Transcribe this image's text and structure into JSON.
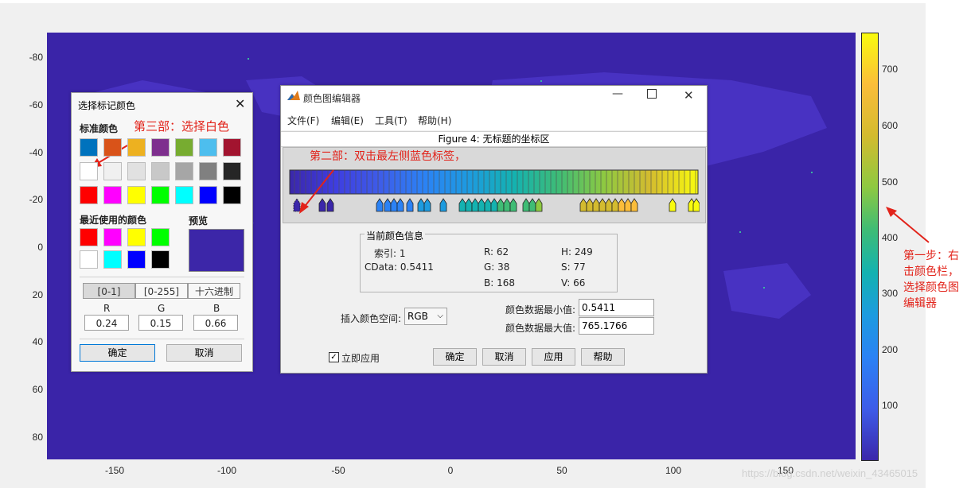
{
  "figure": {
    "y_ticks": [
      "-80",
      "-60",
      "-40",
      "-20",
      "0",
      "20",
      "40",
      "60",
      "80"
    ],
    "x_ticks": [
      "-150",
      "-100",
      "-50",
      "0",
      "50",
      "100",
      "150"
    ],
    "colorbar_ticks": [
      "700",
      "600",
      "500",
      "400",
      "300",
      "200",
      "100"
    ],
    "colormap_colors": [
      "#3b27aa",
      "#3e5ce8",
      "#2b82f5",
      "#1d9bdf",
      "#14b2b0",
      "#3fbc75",
      "#8ec941",
      "#d3bb2f",
      "#fbbd3a",
      "#f9fb0e"
    ],
    "background_color": "#3a24a8"
  },
  "annotations": {
    "step1": "第一步：右击颜色栏，选择颜色图编辑器",
    "step2": "第二部：双击最左侧蓝色标签，",
    "step3": "第三部：选择白色",
    "color": "#e2231a"
  },
  "marker_dialog": {
    "title": "选择标记颜色",
    "standard_colors_label": "标准颜色",
    "standard_colors": [
      "#0072bd",
      "#d95319",
      "#edb120",
      "#7e2f8e",
      "#77ac30",
      "#4dbeee",
      "#a2142f",
      "#ffffff",
      "#f0f0f0",
      "#e1e1e1",
      "#c8c8c8",
      "#a6a6a6",
      "#808080",
      "#262626",
      "#ff0000",
      "#ff00ff",
      "#ffff00",
      "#00ff00",
      "#00ffff",
      "#0000ff",
      "#000000"
    ],
    "recent_colors_label": "最近使用的颜色",
    "recent_colors": [
      "#ff0000",
      "#ff00ff",
      "#ffff00",
      "#00ff00",
      "#ffffff",
      "#00ffff",
      "#0000ff",
      "#000000"
    ],
    "preview_label": "预览",
    "preview_color": "#3c26a8",
    "modes": [
      "[0-1]",
      "[0-255]",
      "十六进制"
    ],
    "r_label": "R",
    "g_label": "G",
    "b_label": "B",
    "r_value": "0.24",
    "g_value": "0.15",
    "b_value": "0.66",
    "ok": "确定",
    "cancel": "取消"
  },
  "colormap_editor": {
    "title": "颜色图编辑器",
    "menus": [
      "文件(F)",
      "编辑(E)",
      "工具(T)",
      "帮助(H)"
    ],
    "axes_title": "Figure 4: 无标题的坐标区",
    "info_group": "当前颜色信息",
    "index_label": "索引: 1",
    "cdata_label": "CData: 0.5411",
    "r_label": "R: 62",
    "g_label": "G: 38",
    "b_label": "B: 168",
    "h_label": "H: 249",
    "s_label": "S: 77",
    "v_label": "V: 66",
    "interp_label": "插入颜色空间:",
    "interp_value": "RGB",
    "min_label": "颜色数据最小值:",
    "min_value": "0.5411",
    "max_label": "颜色数据最大值:",
    "max_value": "765.1766",
    "apply_immediately": "立即应用",
    "ok": "确定",
    "cancel": "取消",
    "apply": "应用",
    "help": "帮助"
  },
  "watermark": "https://blog.csdn.net/weixin_43465015"
}
